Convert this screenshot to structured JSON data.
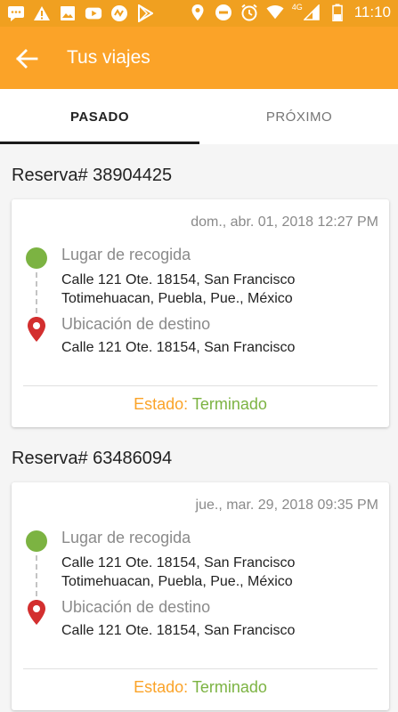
{
  "statusbar": {
    "network": "4G",
    "time": "11:10"
  },
  "appbar": {
    "title": "Tus viajes"
  },
  "tabs": [
    {
      "label": "PASADO",
      "active": true
    },
    {
      "label": "PRÓXIMO",
      "active": false
    }
  ],
  "trips": [
    {
      "booking": "Reserva# 38904425",
      "date": "dom., abr. 01, 2018 12:27 PM",
      "pickup_label": "Lugar de recogida",
      "pickup_address": "Calle 121 Ote. 18154, San Francisco Totimehuacan, Puebla, Pue., México",
      "dropoff_label": "Ubicación de destino",
      "dropoff_address": "Calle 121 Ote. 18154, San Francisco",
      "status_label": "Estado:",
      "status_value": "Terminado"
    },
    {
      "booking": "Reserva# 63486094",
      "date": "jue., mar. 29, 2018 09:35 PM",
      "pickup_label": "Lugar de recogida",
      "pickup_address": "Calle 121 Ote. 18154, San Francisco Totimehuacan, Puebla, Pue., México",
      "dropoff_label": "Ubicación de destino",
      "dropoff_address": "Calle 121 Ote. 18154, San Francisco",
      "status_label": "Estado:",
      "status_value": "Terminado"
    }
  ],
  "colors": {
    "appbar": "#fba328",
    "statusbar": "#f0a020",
    "pickup_dot": "#7cb342",
    "destination_pin": "#d32f2f",
    "status_label": "#fba328",
    "status_value": "#7cb342"
  },
  "icons": {
    "statusbar_left": [
      "message-icon",
      "warning-icon",
      "image-icon",
      "youtube-icon",
      "app-icon",
      "play-store-icon"
    ],
    "statusbar_right": [
      "location-icon",
      "do-not-disturb-icon",
      "alarm-icon",
      "wifi-icon",
      "signal-icon",
      "battery-icon"
    ],
    "back": "arrow-left-icon",
    "pickup": "green-dot-icon",
    "destination": "map-pin-icon"
  }
}
